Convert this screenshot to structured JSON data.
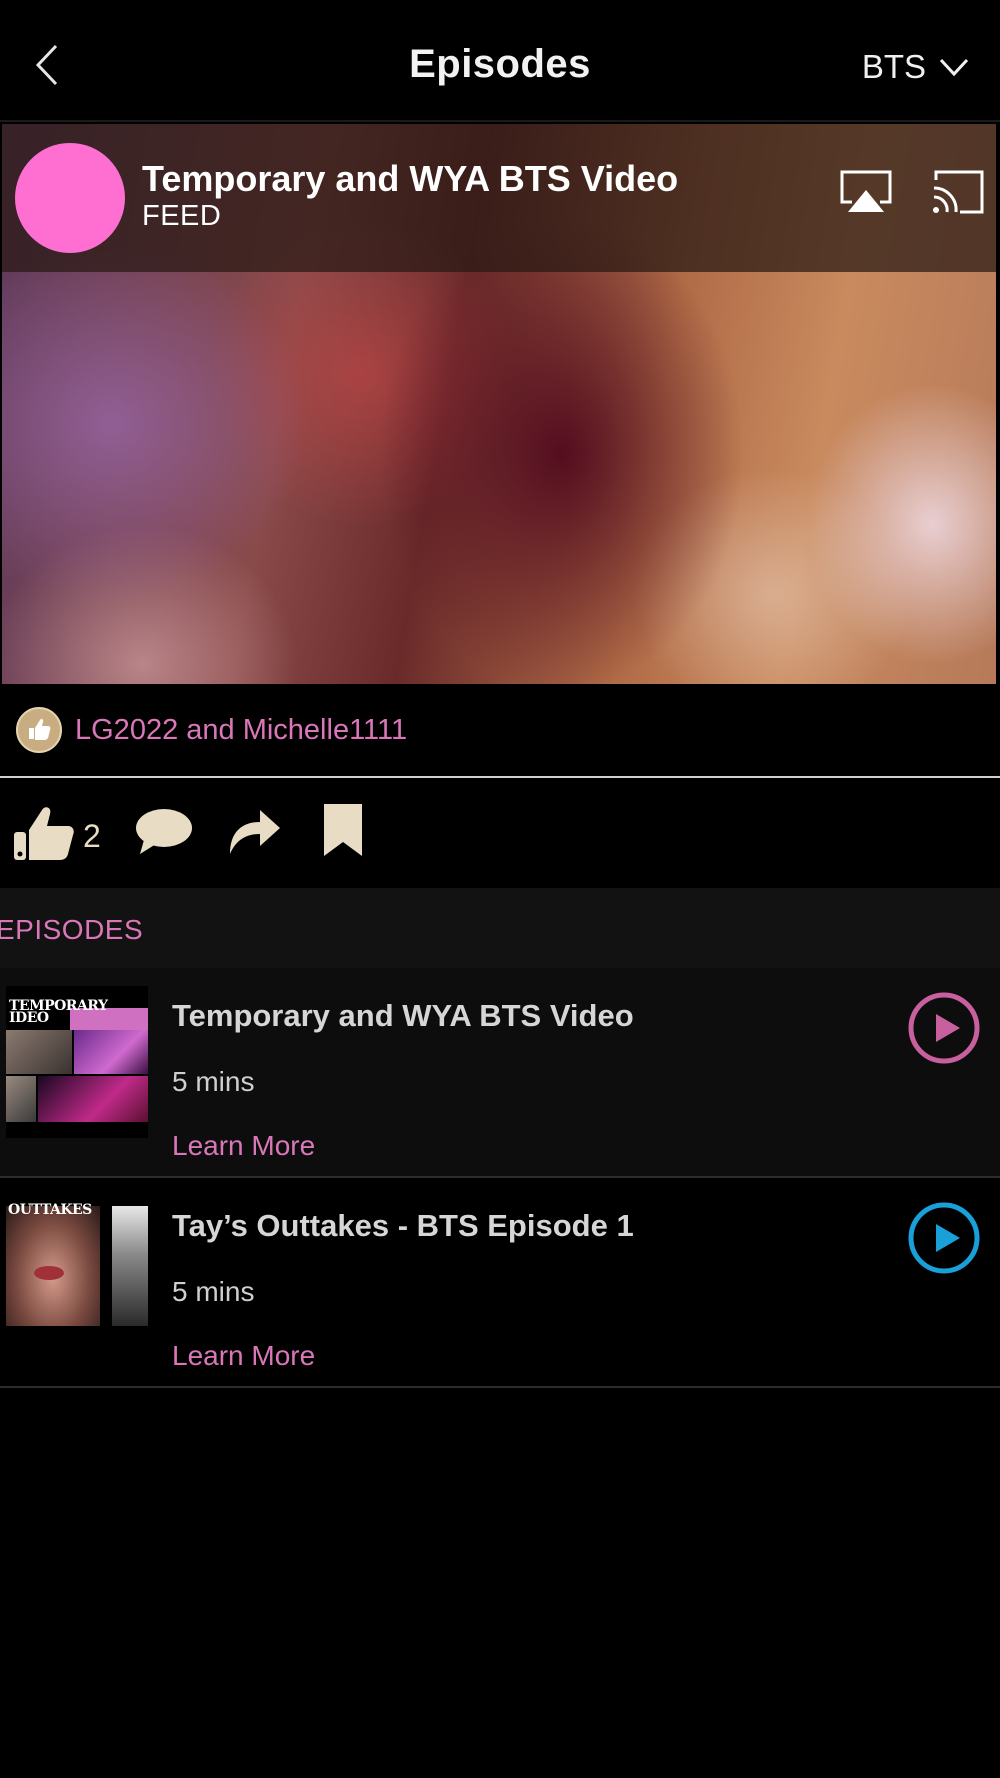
{
  "header": {
    "title": "Episodes",
    "show_selector": "BTS"
  },
  "player": {
    "title": "Temporary and WYA BTS Video",
    "channel": "FEED",
    "avatar_color": "#ff6fd2"
  },
  "likes": {
    "liked_by": "LG2022 and Michelle1111",
    "count": "2"
  },
  "episodes": {
    "section_label": "EPISODES",
    "items": [
      {
        "title": "Temporary and WYA BTS Video",
        "duration": "5 mins",
        "link": "Learn More",
        "thumb_caption": "TEMPORARY IDEO",
        "play_color": "#c8609f"
      },
      {
        "title": "Tay’s Outtakes - BTS Episode 1",
        "duration": "5 mins",
        "link": "Learn More",
        "thumb_caption": "OUTTAKES",
        "play_color": "#1aa0d8"
      }
    ]
  },
  "colors": {
    "accent_pink": "#d977b8",
    "icon_beige": "#e8dcc4",
    "background": "#000000"
  },
  "icons": [
    "back-chevron-icon",
    "chevron-down-icon",
    "airplay-icon",
    "cast-icon",
    "thumbs-up-icon",
    "comment-icon",
    "share-icon",
    "bookmark-icon",
    "play-circle-icon"
  ]
}
